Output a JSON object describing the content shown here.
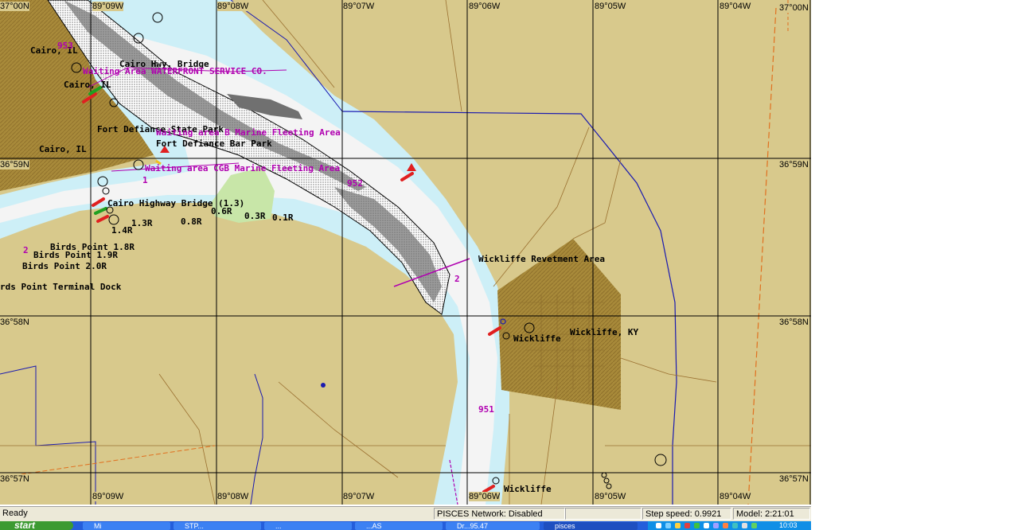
{
  "coordinates": {
    "top_longitudes": [
      "89°09W",
      "89°08W",
      "89°07W",
      "89°06W",
      "89°05W",
      "89°04W"
    ],
    "bottom_longitudes": [
      "89°09W",
      "89°08W",
      "89°07W",
      "89°06W",
      "89°05W",
      "89°04W"
    ],
    "top_left_corner": "37°00N",
    "top_right_corner": "37°00N",
    "left_latitudes": [
      "36°59N",
      "36°58N",
      "36°57N"
    ],
    "right_latitudes": [
      "36°59N",
      "36°58N",
      "36°57N"
    ]
  },
  "labels": {
    "cairo_il_1": "Cairo, IL",
    "cairo_il_2": "Cairo, IL",
    "cairo_il_3": "Cairo, IL",
    "cairo_hwy_bridge": "Cairo Hwy. Bridge",
    "waiting_waterfront": "Waiting Area WATERFRONT SERVICE CO.",
    "fort_defiance_park": "Fort Defiance State Park",
    "waiting_fleeting": "Waiting area B Marine Fleeting Area",
    "fort_defiance_bar": "Fort Defiance Bar Park",
    "waiting_cgb": "Waiting area CGB Marine Fleeting Area",
    "cairo_highway_bridge": "Cairo Highway Bridge (1.3)",
    "mile_06r": "0.6R",
    "mile_03r": "0.3R",
    "mile_01r": "0.1R",
    "mile_13r": "1.3R",
    "mile_08r": "0.8R",
    "mile_14r": "1.4R",
    "birds_point_18": "Birds Point 1.8R",
    "birds_point_19": "Birds Point 1.9R",
    "birds_point_20": "Birds Point 2.0R",
    "birds_point_terminal": "rds Point Terminal Dock",
    "wickliffe_revetment": "Wickliffe Revetment Area",
    "wickliffe_ky": "Wickliffe, KY",
    "wickliffe_1": "Wickliffe",
    "wickliffe_2": "Wickliffe",
    "mile_951": "951",
    "mile_953": "953",
    "mile_952": "952",
    "mile_1": "1",
    "mile_2": "2",
    "mile_2b": "2"
  },
  "status_bar": {
    "ready": "Ready",
    "network": "PISCES Network: Disabled",
    "blank": "",
    "step_speed": "Step speed: 0.9921",
    "model_time": "Model: 2:21:01"
  },
  "taskbar": {
    "start_label": "start",
    "buttons": [
      "Mi",
      "STP...",
      "...",
      "...AS",
      "Dr...95.47",
      "pisces"
    ],
    "clock": "10:03"
  },
  "colors": {
    "land": "#d8c98c",
    "water": "#cdeff7",
    "channel": "#f4f4f4",
    "urban": "#a88a3a",
    "park": "#c8e6a8",
    "magenta": "#b000b0",
    "grid": "#000000",
    "boundary": "#1a1ab0"
  }
}
